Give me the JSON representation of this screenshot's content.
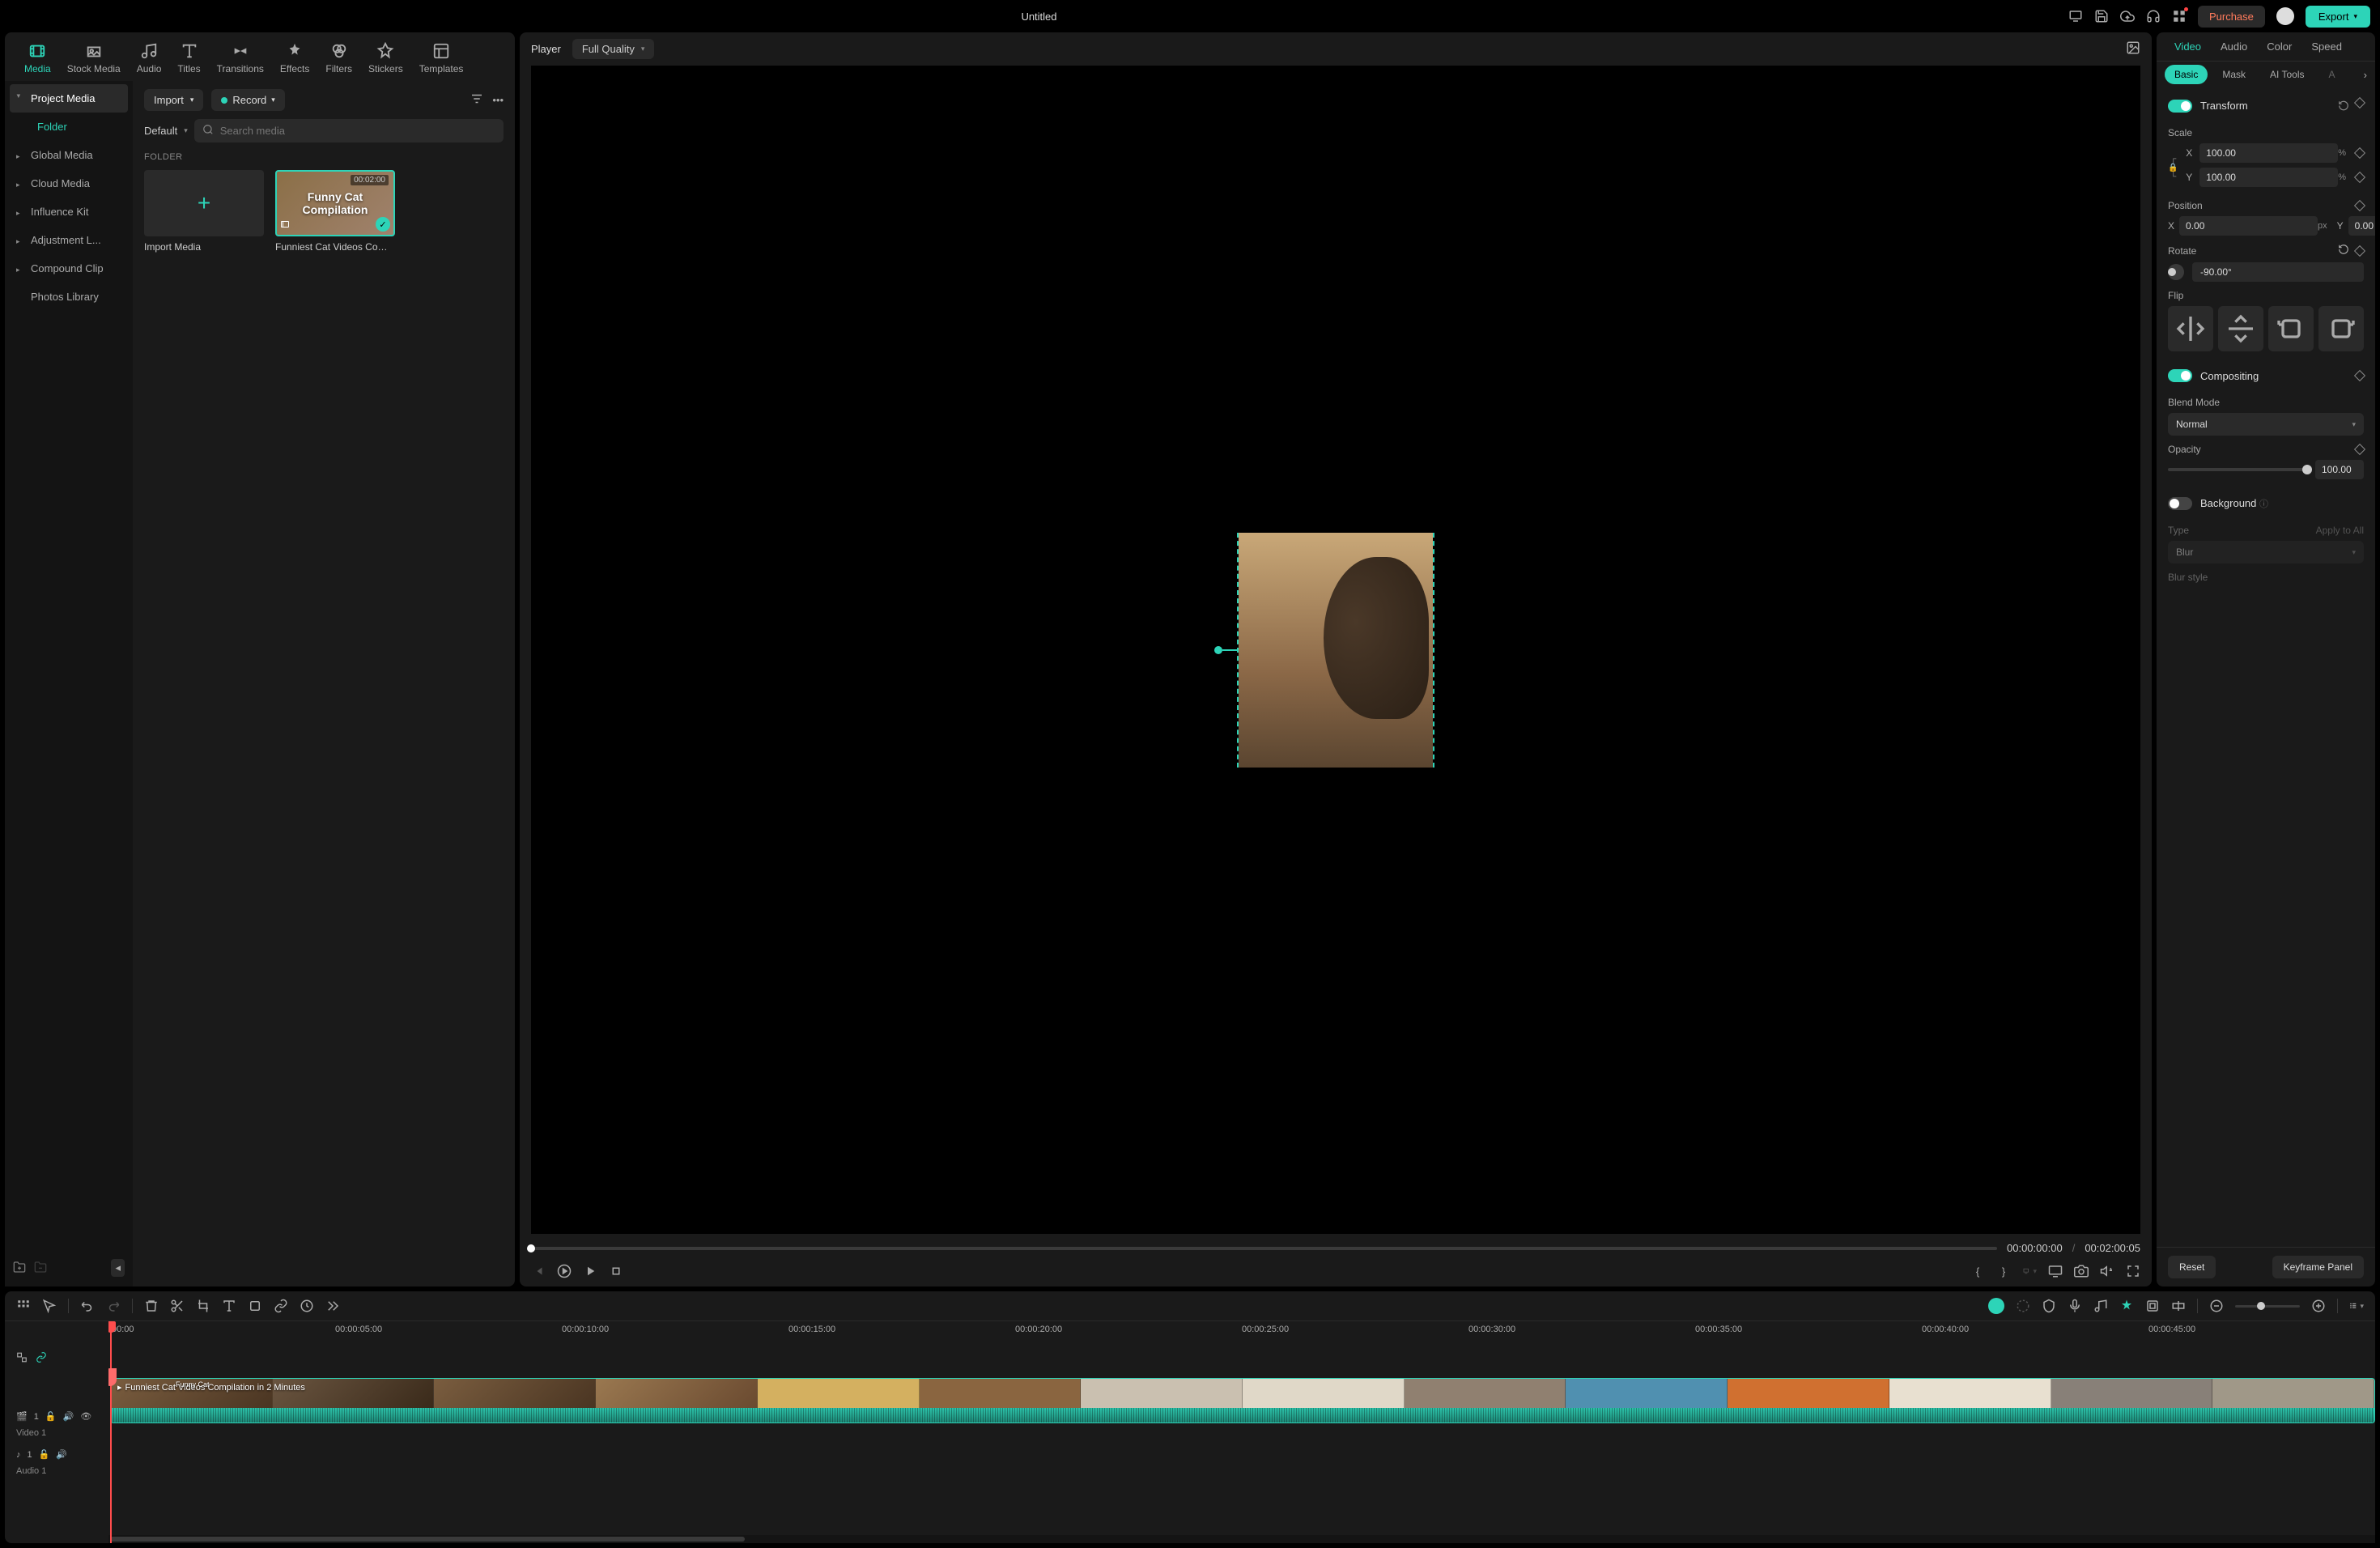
{
  "titlebar": {
    "title": "Untitled",
    "purchase": "Purchase",
    "export": "Export"
  },
  "topTabs": [
    "Media",
    "Stock Media",
    "Audio",
    "Titles",
    "Transitions",
    "Effects",
    "Filters",
    "Stickers",
    "Templates"
  ],
  "sidebar": {
    "items": [
      "Project Media",
      "Folder",
      "Global Media",
      "Cloud Media",
      "Influence Kit",
      "Adjustment L...",
      "Compound Clip",
      "Photos Library"
    ]
  },
  "mediaToolbar": {
    "import": "Import",
    "record": "Record",
    "default": "Default",
    "searchPlaceholder": "Search media",
    "folderLabel": "FOLDER",
    "importMedia": "Import Media",
    "clipTitle1": "Funny Cat",
    "clipTitle2": "Compilation",
    "clipDuration": "00:02:00",
    "clipName": "Funniest Cat Videos Compi..."
  },
  "player": {
    "label": "Player",
    "quality": "Full Quality",
    "current": "00:00:00:00",
    "sep": "/",
    "total": "00:02:00:05"
  },
  "props": {
    "tabs": [
      "Video",
      "Audio",
      "Color",
      "Speed"
    ],
    "subtabs": [
      "Basic",
      "Mask",
      "AI Tools",
      "A"
    ],
    "transform": "Transform",
    "scale": "Scale",
    "scaleX": "100.00",
    "scaleY": "100.00",
    "pct": "%",
    "position": "Position",
    "posX": "0.00",
    "posY": "0.00",
    "px": "px",
    "rotate": "Rotate",
    "rotateVal": "-90.00°",
    "flip": "Flip",
    "compositing": "Compositing",
    "blendMode": "Blend Mode",
    "blendVal": "Normal",
    "opacity": "Opacity",
    "opacityVal": "100.00",
    "background": "Background",
    "type": "Type",
    "applyAll": "Apply to All",
    "typeVal": "Blur",
    "blurStyle": "Blur style",
    "reset": "Reset",
    "kfPanel": "Keyframe Panel",
    "x": "X",
    "y": "Y"
  },
  "timeline": {
    "marks": [
      "00:00",
      "00:00:05:00",
      "00:00:10:00",
      "00:00:15:00",
      "00:00:20:00",
      "00:00:25:00",
      "00:00:30:00",
      "00:00:35:00",
      "00:00:40:00",
      "00:00:45:00"
    ],
    "video1": "Video 1",
    "audio1": "Audio 1",
    "videoTrackNum": "1",
    "audioTrackNum": "1",
    "clipLabel": "Funniest Cat Videos Compilation in 2 Minutes",
    "thumbBadge": "Funny Cat"
  }
}
